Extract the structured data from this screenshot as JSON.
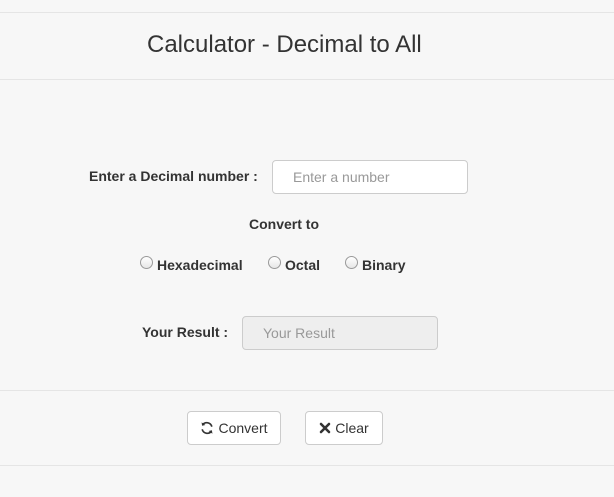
{
  "header": {
    "title": "Calculator - Decimal to All"
  },
  "form": {
    "decimal_label": "Enter a Decimal number :",
    "decimal_placeholder": "Enter a number",
    "decimal_value": "",
    "convert_to_label": "Convert to",
    "options": [
      {
        "label": "Hexadecimal",
        "selected": false
      },
      {
        "label": "Octal",
        "selected": false
      },
      {
        "label": "Binary",
        "selected": false
      }
    ],
    "result_label": "Your Result :",
    "result_placeholder": "Your Result",
    "result_value": ""
  },
  "actions": {
    "convert_label": "Convert",
    "convert_icon": "refresh-icon",
    "clear_label": "Clear",
    "clear_icon": "times-icon"
  }
}
